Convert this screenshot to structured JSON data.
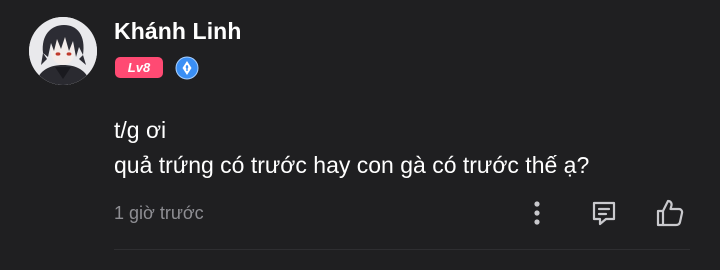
{
  "comment": {
    "user": {
      "name": "Khánh Linh",
      "level": "Lv8",
      "avatar_icon": "anime-avatar",
      "rank_icon": "pen-nib-badge-icon"
    },
    "text_lines": [
      "t/g ơi",
      "quả trứng có trước hay con gà có trước thế ạ?"
    ],
    "timestamp": "1 giờ trước",
    "actions": {
      "more_icon": "more-vertical-icon",
      "reply_icon": "reply-icon",
      "like_icon": "thumbs-up-icon"
    }
  },
  "colors": {
    "background": "#1f1f21",
    "level_badge": "#ff4a73",
    "rank_badge": "#3a8ff5",
    "muted_text": "#8e8e93"
  }
}
